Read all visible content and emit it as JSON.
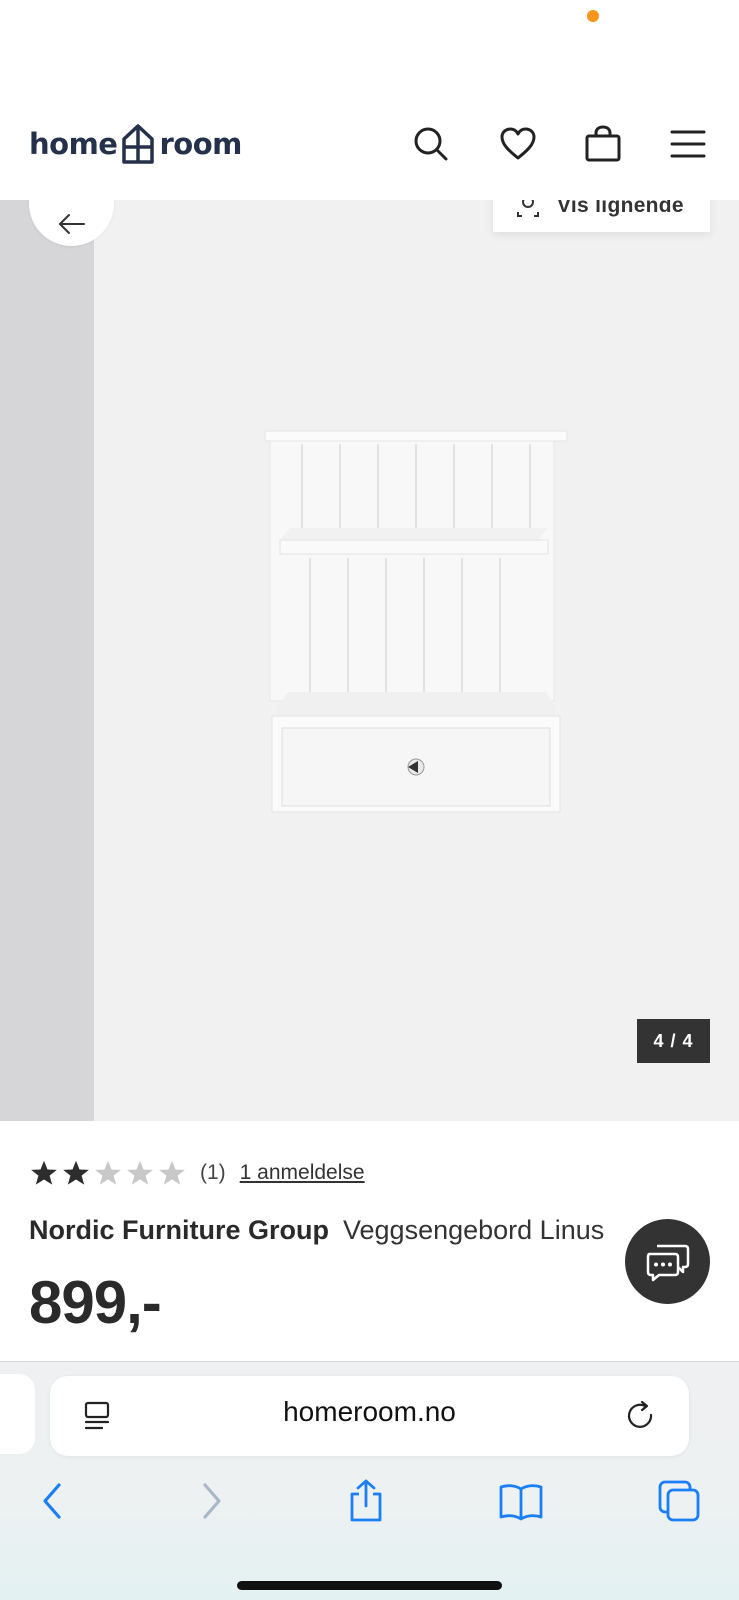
{
  "status_bar": {
    "indicator_color": "#f7941d"
  },
  "header": {
    "logo_left": "home",
    "logo_right": "room",
    "icons": [
      "search-icon",
      "heart-icon",
      "shopping-bag-icon",
      "menu-icon"
    ]
  },
  "gallery": {
    "similar_label": "Vis lignende",
    "counter": "4 / 4",
    "current_image": 4,
    "total_images": 4
  },
  "product": {
    "rating": 2,
    "rating_max": 5,
    "rating_count": "(1)",
    "reviews_link": "1 anmeldelse",
    "brand": "Nordic Furniture Group",
    "name": "Veggsengebord Linus",
    "price": "899,-"
  },
  "browser": {
    "url": "homeroom.no",
    "toolbar": [
      "back-icon",
      "forward-icon",
      "share-icon",
      "bookmarks-icon",
      "tabs-icon"
    ]
  },
  "colors": {
    "brand_navy": "#25304a",
    "dark": "#333333",
    "accent_orange": "#f7941d",
    "ios_blue": "#1a7ff5"
  }
}
